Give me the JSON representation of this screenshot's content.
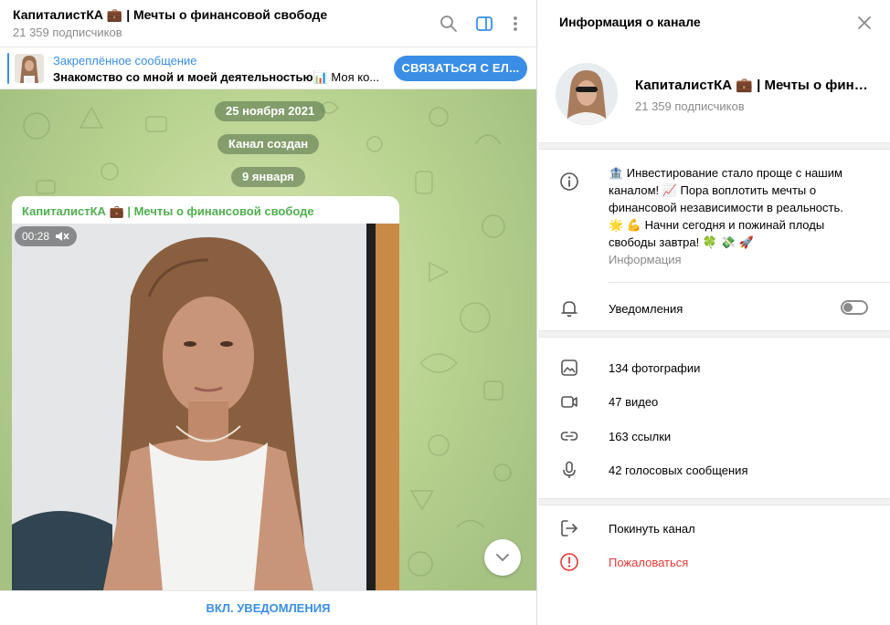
{
  "chat": {
    "title": "КапиталистКА 💼 | Мечты о финансовой свободе",
    "subscribers": "21 359 подписчиков",
    "pinned_title": "Закреплённое сообщение",
    "pinned_bold": "Знакомство со мной и моей деятельностью📊",
    "pinned_rest": " Моя ко...",
    "contact_button": "СВЯЗАТЬСЯ С ЕЛ...",
    "service": {
      "date1": "25 ноября 2021",
      "created": "Канал создан",
      "date2": "9 января"
    },
    "message": {
      "author": "КапиталистКА 💼 | Мечты о финансовой свободе",
      "duration": "00:28"
    },
    "bottom_button": "ВКЛ. УВЕДОМЛЕНИЯ"
  },
  "info": {
    "panel_title": "Информация о канале",
    "name": "КапиталистКА 💼 | Мечты о финансовой свободе",
    "subscribers": "21 359 подписчиков",
    "description": [
      "🏦 Инвестирование стало проще с нашим",
      "каналом! 📈 Пора воплотить мечты о",
      "финансовой независимости в реальность.",
      "🌟 💪 Начни сегодня и пожинай плоды",
      "свободы завтра! 🍀 💸 🚀"
    ],
    "description_label": "Информация",
    "notifications_label": "Уведомления",
    "notifications_on": false,
    "media": {
      "photos": "134 фотографии",
      "videos": "47 видео",
      "links": "163 ссылки",
      "voice": "42 голосовых сообщения"
    },
    "leave": "Покинуть канал",
    "report": "Пожаловаться"
  },
  "colors": {
    "accent": "#3a8ee6",
    "author": "#4fae4e",
    "danger": "#e53935",
    "muted": "#8a8a8a"
  }
}
